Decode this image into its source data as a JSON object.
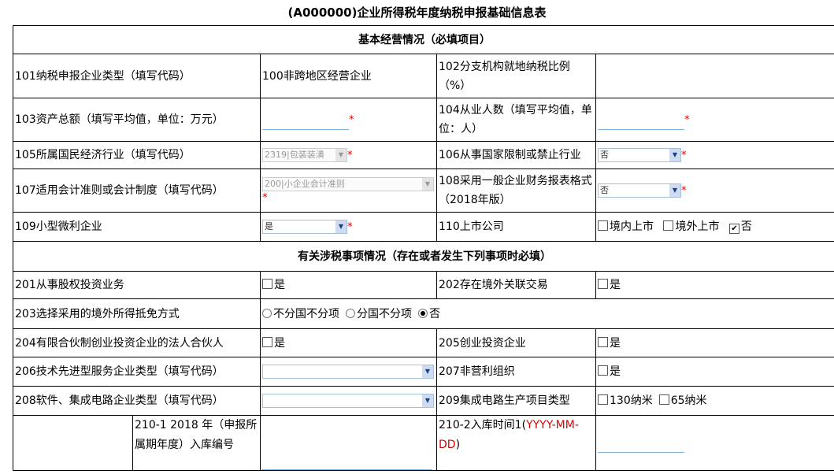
{
  "title": "(A000000)企业所得税年度纳税申报基础信息表",
  "sec1": "基本经营情况（必填项目）",
  "r101": {
    "label": "101纳税申报企业类型（填写代码）",
    "value": "100非跨地区经营企业"
  },
  "r102": {
    "label": "102分支机构就地纳税比例（%）"
  },
  "r103": {
    "label": "103资产总额（填写平均值，单位：万元）"
  },
  "r104": {
    "label": "104从业人数（填写平均值，单位：人）"
  },
  "r105": {
    "label": "105所属国民经济行业（填写代码）",
    "value": "2319|包装装潢"
  },
  "r106": {
    "label": "106从事国家限制或禁止行业",
    "value": "否"
  },
  "r107": {
    "label": "107适用会计准则或会计制度（填写代码）",
    "value": "200|小企业会计准则"
  },
  "r108": {
    "label": "108采用一般企业财务报表格式（2018年版）",
    "value": "否"
  },
  "r109": {
    "label": "109小型微利企业",
    "value": "是"
  },
  "r110": {
    "label": "110上市公司",
    "opt1": "境内上市",
    "opt2": "境外上市",
    "opt3": "否",
    "checked": "否"
  },
  "sec2": "有关涉税事项情况（存在或者发生下列事项时必填）",
  "r201": {
    "label": "201从事股权投资业务",
    "cb": "是"
  },
  "r202": {
    "label": "202存在境外关联交易",
    "cb": "是"
  },
  "r203": {
    "label": "203选择采用的境外所得抵免方式",
    "opt1": "不分国不分项",
    "opt2": "分国不分项",
    "opt3": "否",
    "selected": "否"
  },
  "r204": {
    "label": "204有限合伙制创业投资企业的法人合伙人",
    "cb": "是"
  },
  "r205": {
    "label": "205创业投资企业",
    "cb": "是"
  },
  "r206": {
    "label": "206技术先进型服务企业类型（填写代码）"
  },
  "r207": {
    "label": "207非营利组织",
    "cb": "是"
  },
  "r208": {
    "label": "208软件、集成电路企业类型（填写代码）"
  },
  "r209": {
    "label": "209集成电路生产项目类型",
    "opt1": "130纳米",
    "opt2": "65纳米"
  },
  "r210": {
    "label1": "210-1 2018 年（申报所属期年度）入库编号",
    "label2a": "210-2入库时间1(",
    "label2b": "YYYY-MM-DD",
    "label2c": ")"
  },
  "required_mark": "*",
  "colors": {
    "required": "#e00000",
    "input_underline": "#7eb1d8",
    "border": "#000000"
  }
}
